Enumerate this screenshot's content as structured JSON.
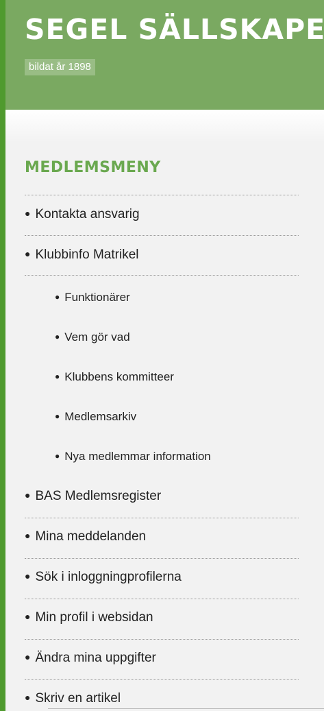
{
  "header": {
    "site_title": "SEGEL SÄLLSKAPET",
    "tagline": "bildat år 1898",
    "colors": {
      "banner": "#7aa961",
      "border": "#4f9a2e",
      "menu_title": "#6aa84f"
    }
  },
  "menu": {
    "title": "MEDLEMSMENY",
    "items": [
      {
        "label": "Kontakta ansvarig",
        "level": 1
      },
      {
        "label": "Klubbinfo Matrikel",
        "level": 1
      },
      {
        "label": "Funktionärer",
        "level": 2
      },
      {
        "label": "Vem gör vad",
        "level": 2
      },
      {
        "label": "Klubbens kommitteer",
        "level": 2
      },
      {
        "label": "Medlemsarkiv",
        "level": 2
      },
      {
        "label": "Nya medlemmar information",
        "level": 2
      },
      {
        "label": "BAS Medlemsregister",
        "level": 1
      },
      {
        "label": "Mina meddelanden",
        "level": 1
      },
      {
        "label": "Sök i inloggningprofilerna",
        "level": 1
      },
      {
        "label": "Min profil i websidan",
        "level": 1
      },
      {
        "label": "Ändra mina uppgifter",
        "level": 1
      },
      {
        "label": "Skriv en artikel",
        "level": 1
      }
    ]
  }
}
